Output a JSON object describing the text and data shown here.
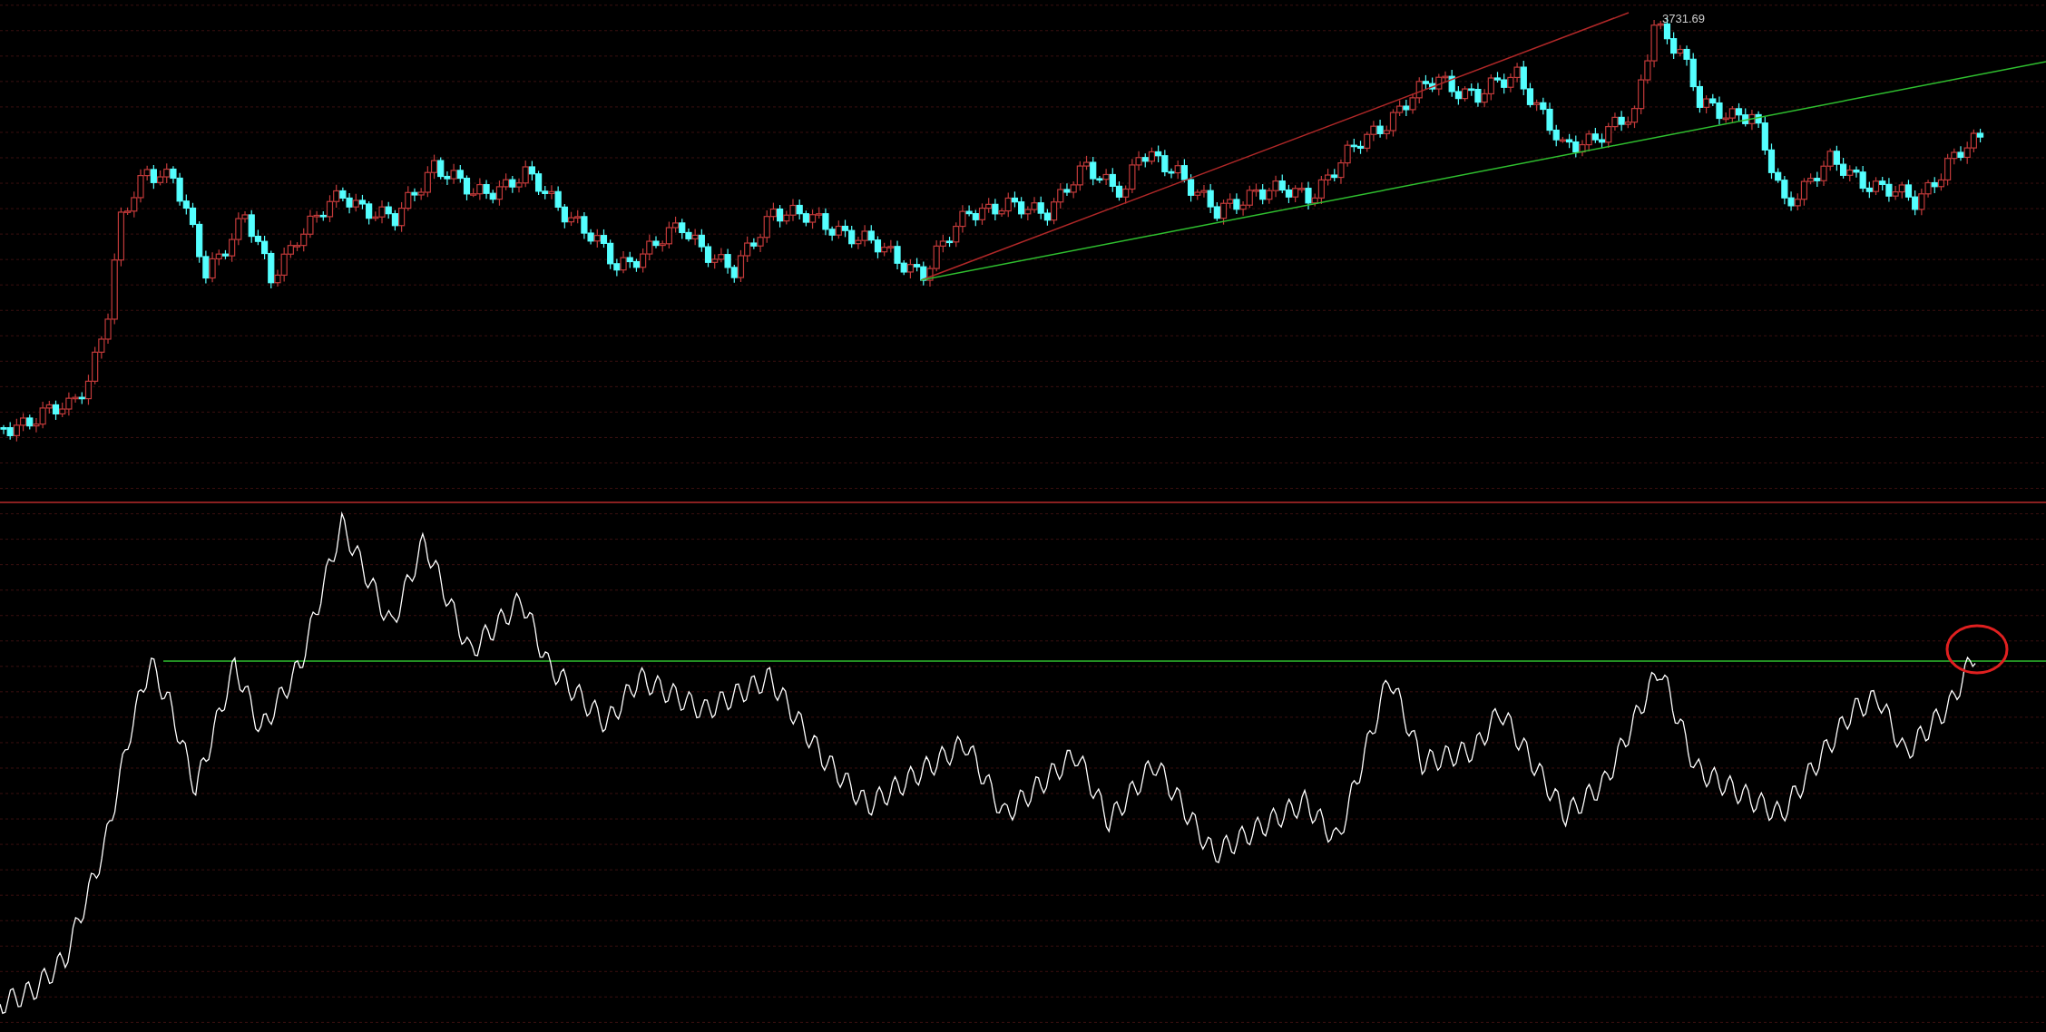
{
  "chart": {
    "peak_label": "3731.69"
  }
}
